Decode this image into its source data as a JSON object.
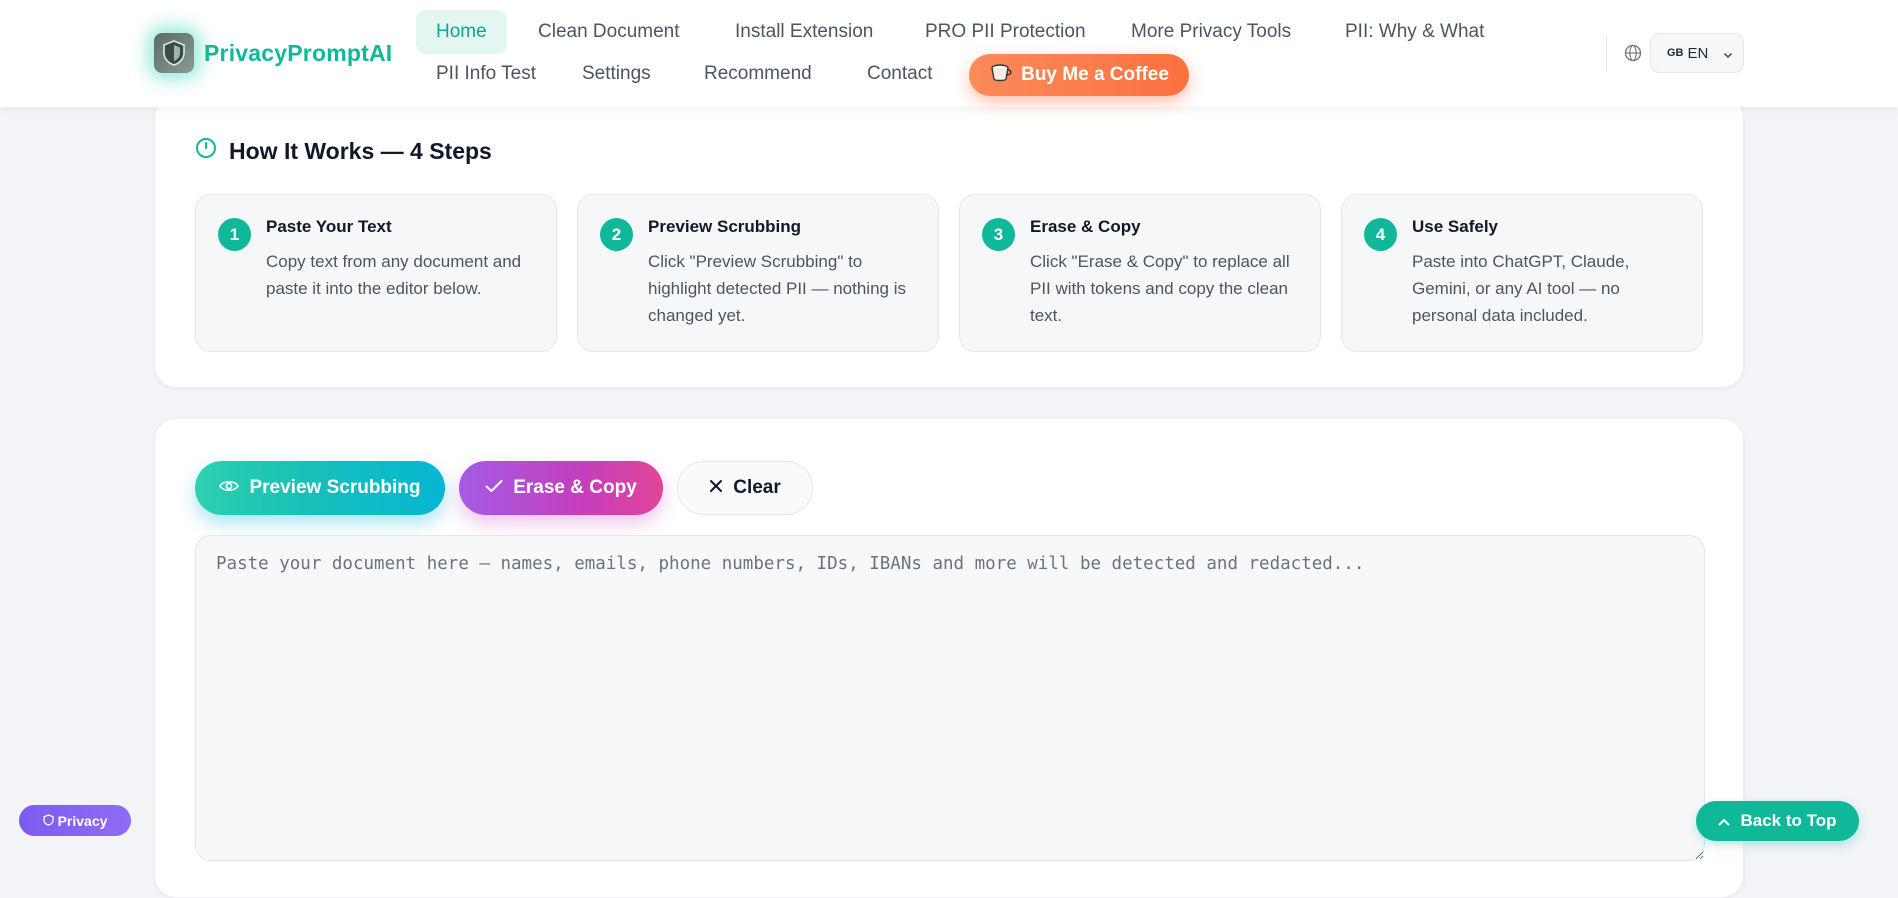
{
  "brand": {
    "name": "PrivacyPromptAI"
  },
  "nav": {
    "row1": [
      {
        "label": "Home",
        "active": true
      },
      {
        "label": "Clean Document"
      },
      {
        "label": "Install Extension"
      },
      {
        "label": "PRO PII Protection"
      },
      {
        "label": "More Privacy Tools"
      },
      {
        "label": "PII: Why & What"
      }
    ],
    "row2": [
      {
        "label": "PII Info Test"
      },
      {
        "label": "Settings"
      },
      {
        "label": "Recommend"
      },
      {
        "label": "Contact"
      }
    ],
    "coffee_label": "Buy Me a Coffee"
  },
  "language": {
    "flag": "GB",
    "code": "EN"
  },
  "steps": {
    "title": "How It Works — 4 Steps",
    "items": [
      {
        "num": "1",
        "title": "Paste Your Text",
        "desc": "Copy text from any document and paste it into the editor below."
      },
      {
        "num": "2",
        "title": "Preview Scrubbing",
        "desc": "Click \"Preview Scrubbing\" to highlight detected PII — nothing is changed yet."
      },
      {
        "num": "3",
        "title": "Erase & Copy",
        "desc": "Click \"Erase & Copy\" to replace all PII with tokens and copy the clean text."
      },
      {
        "num": "4",
        "title": "Use Safely",
        "desc": "Paste into ChatGPT, Claude, Gemini, or any AI tool — no personal data included."
      }
    ]
  },
  "editor": {
    "preview_label": "Preview Scrubbing",
    "erase_label": "Erase & Copy",
    "clear_label": "Clear",
    "placeholder": "Paste your document here — names, emails, phone numbers, IDs, IBANs and more will be detected and redacted...",
    "value": ""
  },
  "floating": {
    "privacy_label": "Privacy",
    "back_to_top_label": "Back to Top"
  },
  "colors": {
    "accent": "#10b89a",
    "coffee": "#fb7140",
    "erase": "#c43fbd",
    "privacy_badge": "#7c5cf0"
  }
}
